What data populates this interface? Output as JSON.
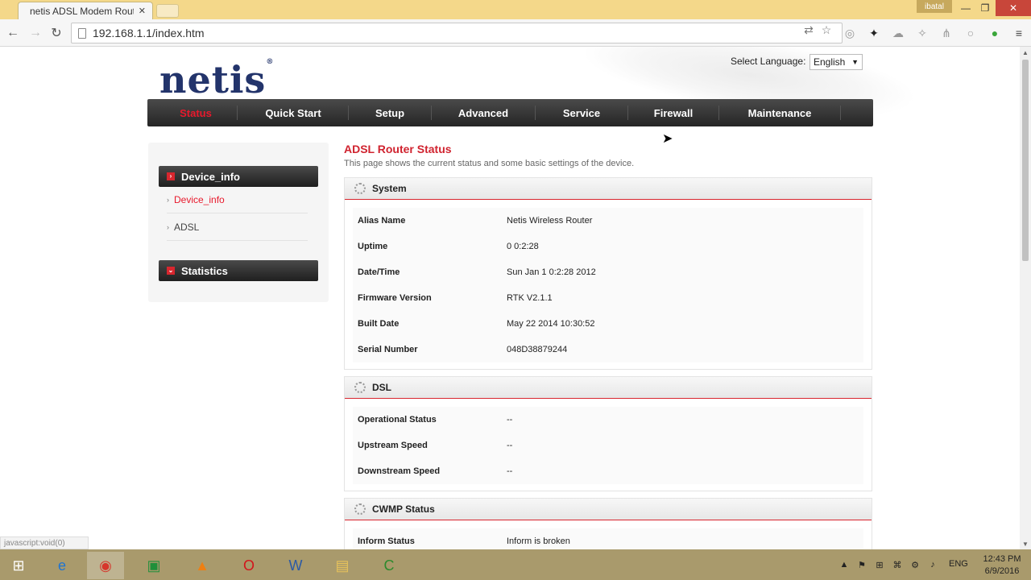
{
  "browser": {
    "tab_title": "netis ADSL Modem Route",
    "tab_close": "✕",
    "user_badge": "ibatal",
    "minimize": "—",
    "restore": "❐",
    "close": "✕",
    "url": "192.168.1.1/index.htm",
    "status_text": "javascript:void(0)"
  },
  "header": {
    "logo": "netis",
    "logo_mark": "®",
    "language_label": "Select Language:",
    "language_value": "English"
  },
  "nav": {
    "items": [
      {
        "label": "Status",
        "active": true
      },
      {
        "label": "Quick Start"
      },
      {
        "label": "Setup"
      },
      {
        "label": "Advanced"
      },
      {
        "label": "Service"
      },
      {
        "label": "Firewall"
      },
      {
        "label": "Maintenance"
      }
    ]
  },
  "sidebar": {
    "groups": [
      {
        "title": "Device_info",
        "items": [
          "Device_info",
          "ADSL"
        ]
      },
      {
        "title": "Statistics"
      }
    ]
  },
  "content": {
    "title": "ADSL Router Status",
    "description": "This page shows the current status and some basic settings of the device.",
    "sections": [
      {
        "title": "System",
        "rows": [
          {
            "label": "Alias Name",
            "value": "Netis Wireless Router"
          },
          {
            "label": "Uptime",
            "value": "0 0:2:28"
          },
          {
            "label": "Date/Time",
            "value": "Sun Jan 1 0:2:28 2012"
          },
          {
            "label": "Firmware Version",
            "value": "RTK V2.1.1"
          },
          {
            "label": "Built Date",
            "value": "May 22 2014 10:30:52"
          },
          {
            "label": "Serial Number",
            "value": "048D38879244"
          }
        ]
      },
      {
        "title": "DSL",
        "rows": [
          {
            "label": "Operational Status",
            "value": "--"
          },
          {
            "label": "Upstream Speed",
            "value": "--"
          },
          {
            "label": "Downstream Speed",
            "value": "--"
          }
        ]
      },
      {
        "title": "CWMP Status",
        "rows": [
          {
            "label": "Inform Status",
            "value": "Inform is broken"
          }
        ]
      }
    ]
  },
  "taskbar": {
    "language": "ENG",
    "time": "12:43 PM",
    "date": "6/9/2016"
  },
  "colors": {
    "accent_red": "#d0232f",
    "logo_navy": "#23346b",
    "nav_dark": "#2b2b2b",
    "titlebar": "#f4d88a",
    "taskbar": "#a99a6c"
  }
}
